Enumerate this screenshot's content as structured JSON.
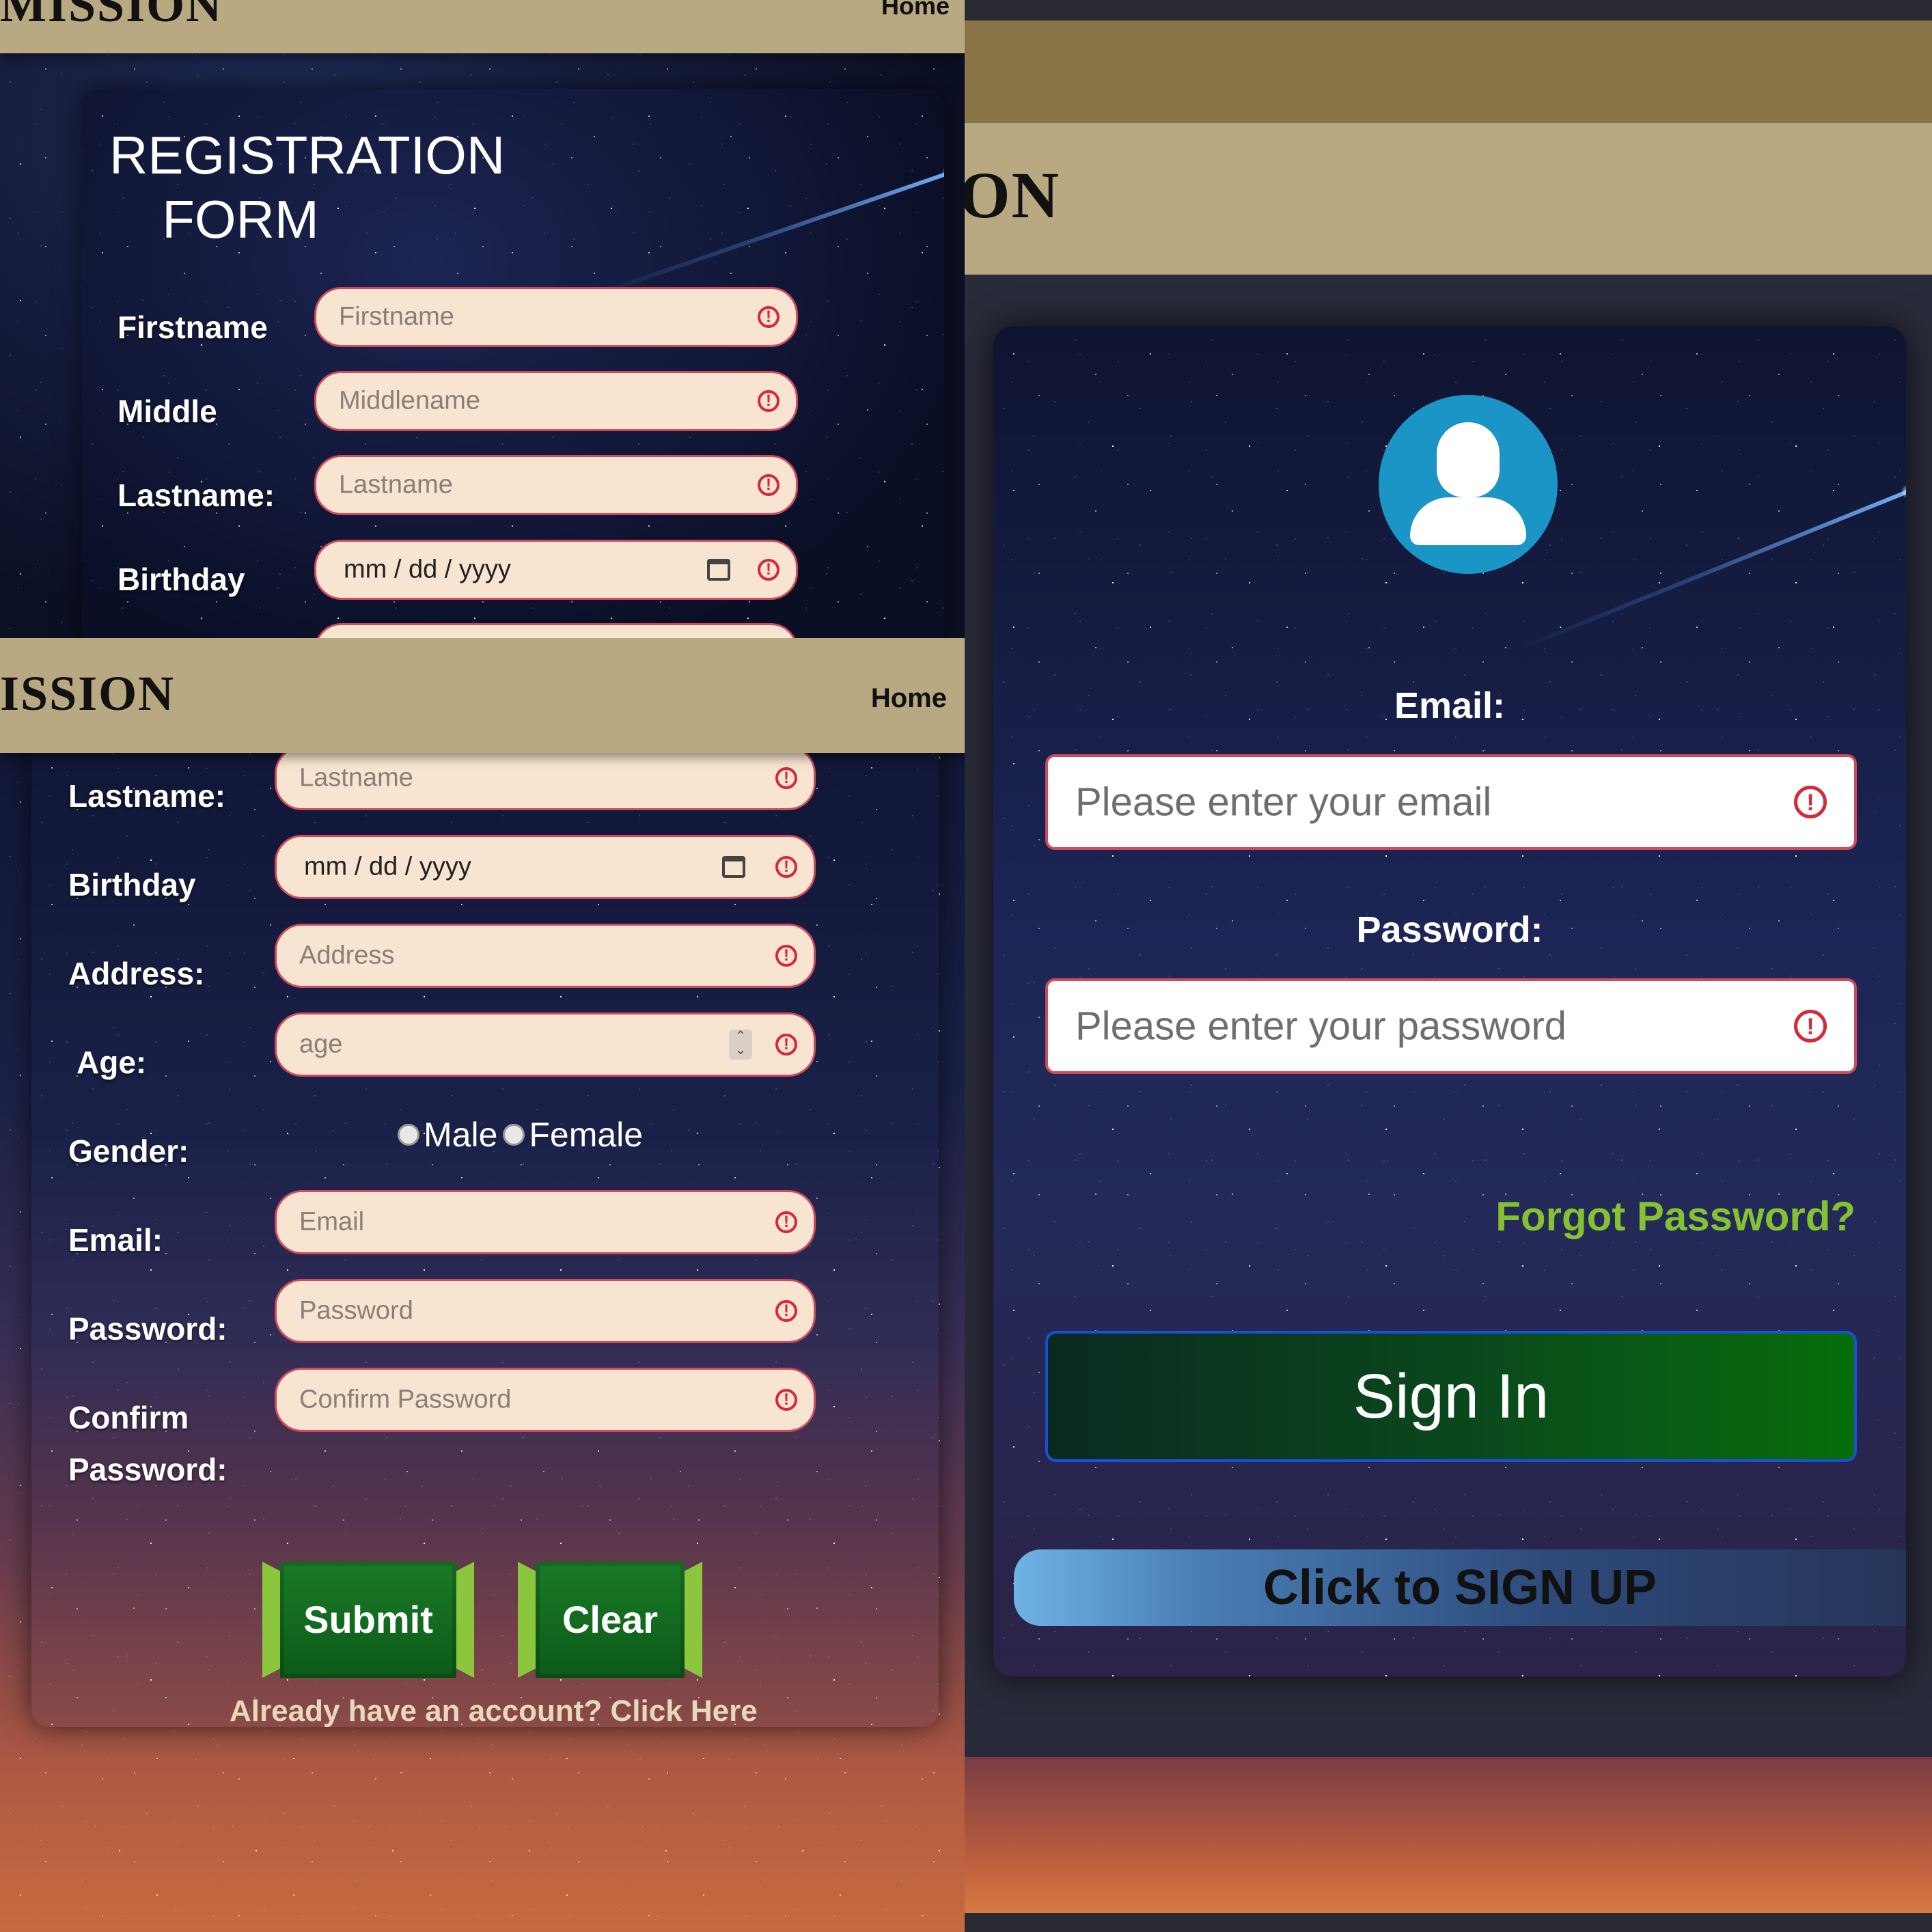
{
  "colors": {
    "header": "#b9a982",
    "field_bg": "#f7e5d1",
    "field_border": "#d04a5e",
    "warning": "#d42a3a",
    "forgot_link": "#84c232",
    "avatar": "#1b94c6"
  },
  "top_left": {
    "brand": "MISSION",
    "nav_home": "Home",
    "title_line1": "REGISTRATION",
    "title_line2": "FORM",
    "fields": [
      {
        "label": "Firstname",
        "placeholder": "Firstname"
      },
      {
        "label": "Middle",
        "placeholder": "Middlename"
      },
      {
        "label": "Lastname:",
        "placeholder": "Lastname"
      },
      {
        "label": "Birthday",
        "value": "mm / dd / yyyy"
      }
    ]
  },
  "bottom_left": {
    "brand": "ISSION",
    "nav_home": "Home",
    "fields": [
      {
        "label": "Lastname:",
        "placeholder": "Lastname"
      },
      {
        "label": "Birthday",
        "value": "mm / dd / yyyy"
      },
      {
        "label": "Address:",
        "placeholder": "Address"
      },
      {
        "label": "Age:",
        "placeholder": "age"
      },
      {
        "label": "Email:",
        "placeholder": "Email"
      },
      {
        "label": "Password:",
        "placeholder": "Password"
      },
      {
        "label_line1": "Confirm",
        "label_line2": "Password:",
        "placeholder": "Confirm Password"
      }
    ],
    "gender_label": "Gender:",
    "gender_options": [
      "Male",
      "Female"
    ],
    "submit": "Submit",
    "clear": "Clear",
    "login_link": "Already have an account? Click Here"
  },
  "right": {
    "brand_fragment": "ON",
    "email_label": "Email:",
    "email_placeholder": "Please enter your email",
    "password_label": "Password:",
    "password_placeholder": "Please enter your password",
    "forgot": "Forgot Password?",
    "signin": "Sign In",
    "signup": "Click to SIGN UP"
  },
  "icons": {
    "warning": "warning-circle-icon",
    "calendar": "calendar-icon",
    "spinner": "number-spinner-icon",
    "user": "user-avatar-icon"
  }
}
